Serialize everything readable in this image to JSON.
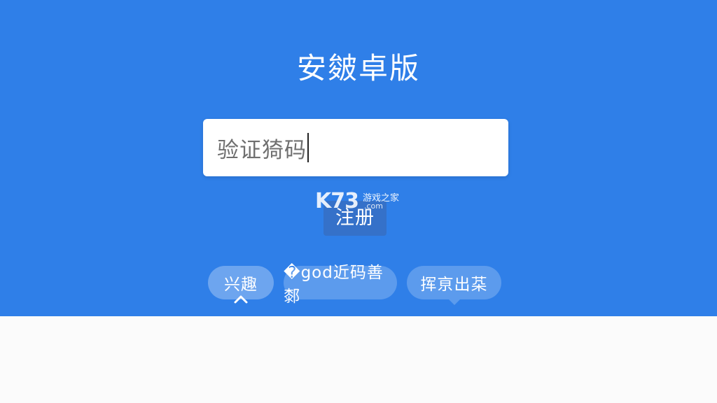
{
  "page": {
    "title": "安皴卓版"
  },
  "form": {
    "code_value": "验证猗码",
    "register_label": "注册"
  },
  "watermark": {
    "logo": "K73",
    "site_cn": "游戏之家",
    "site_domain": ".com"
  },
  "tabs": [
    {
      "label": "兴趣",
      "active": true
    },
    {
      "label": "�god近码善䣛",
      "active": false
    },
    {
      "label": "挥亰出䒳",
      "active": false
    }
  ],
  "colors": {
    "accent": "#2f7fe8",
    "button": "#3571c9",
    "lower_background": "#fbfbfb"
  }
}
